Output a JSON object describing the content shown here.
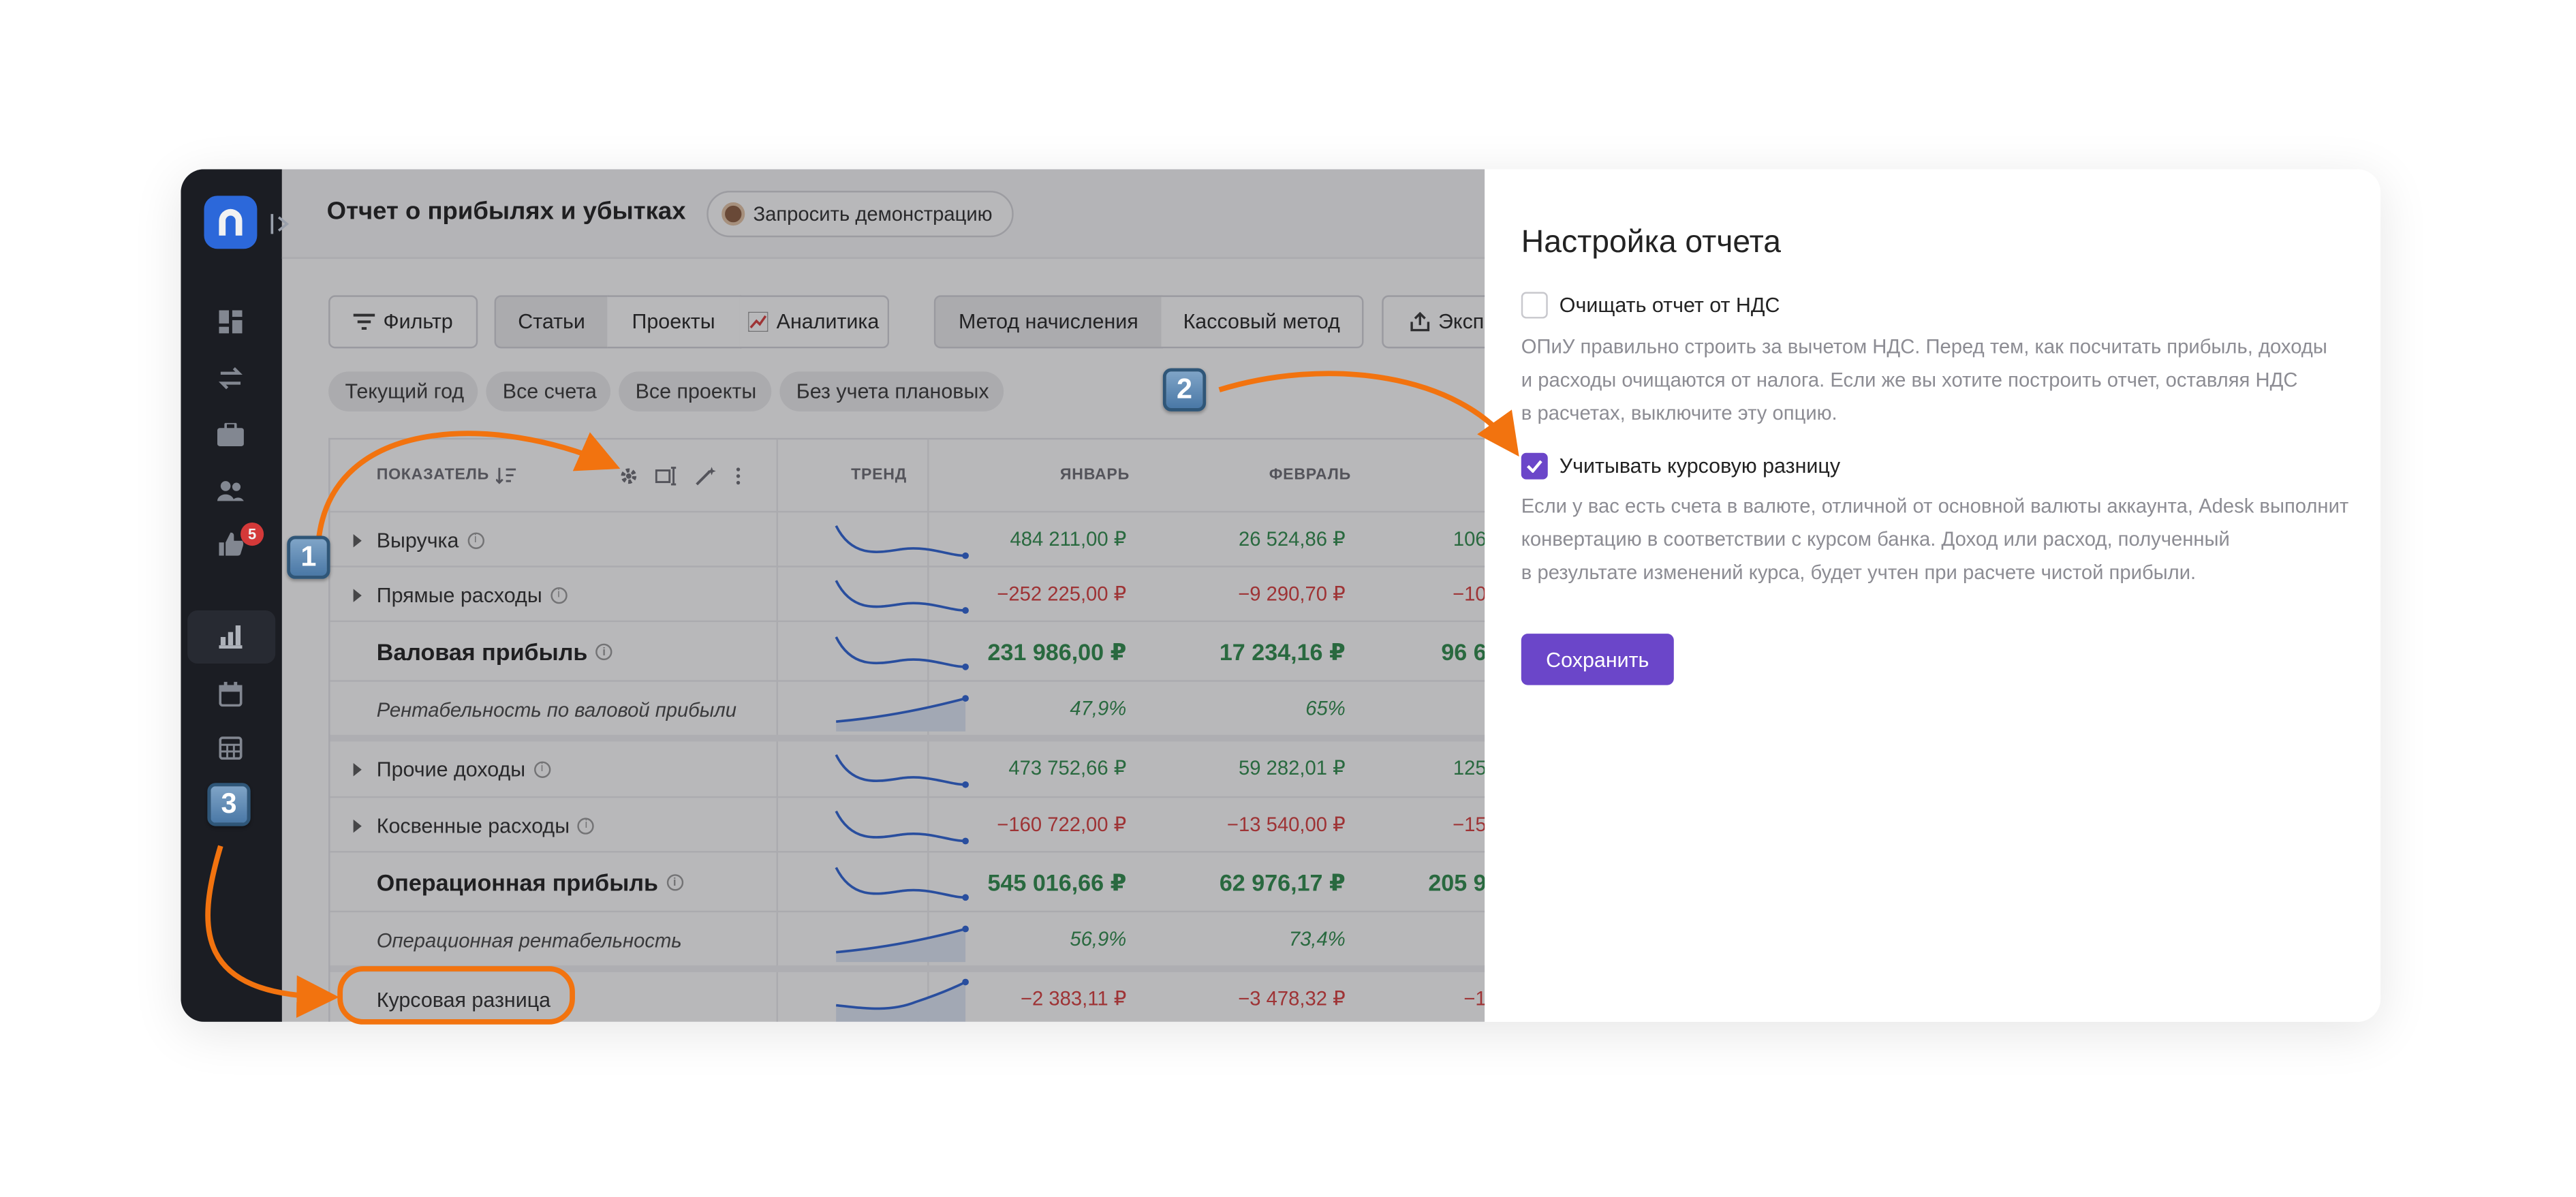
{
  "app": {
    "title": "Отчет о прибылях и убытках",
    "demo_button": "Запросить демонстрацию",
    "sidebar_badge": "5"
  },
  "toolbar": {
    "filter": "Фильтр",
    "tabs": [
      "Статьи",
      "Проекты",
      "Аналитика"
    ],
    "methods": [
      "Метод начисления",
      "Кассовый метод"
    ],
    "export": "Эксп"
  },
  "chips": [
    "Текущий год",
    "Все счета",
    "Все проекты",
    "Без учета плановых"
  ],
  "table": {
    "headers": {
      "indicator": "ПОКАЗАТЕЛЬ",
      "trend": "ТРЕНД",
      "jan": "ЯНВАРЬ",
      "feb": "ФЕВРАЛЬ"
    },
    "rows": [
      {
        "label": "Выручка",
        "jan": "484 211,00 ₽",
        "feb": "26 524,86 ₽",
        "mar": "106"
      },
      {
        "label": "Прямые расходы",
        "jan": "−252 225,00 ₽",
        "feb": "−9 290,70 ₽",
        "mar": "−10"
      },
      {
        "label": "Валовая прибыль",
        "jan": "231 986,00 ₽",
        "feb": "17 234,16 ₽",
        "mar": "96 6"
      },
      {
        "label": "Рентабельность по валовой прибыли",
        "jan": "47,9%",
        "feb": "65%",
        "mar": ""
      },
      {
        "label": "Прочие доходы",
        "jan": "473 752,66 ₽",
        "feb": "59 282,01 ₽",
        "mar": "125"
      },
      {
        "label": "Косвенные расходы",
        "jan": "−160 722,00 ₽",
        "feb": "−13 540,00 ₽",
        "mar": "−15"
      },
      {
        "label": "Операционная прибыль",
        "jan": "545 016,66 ₽",
        "feb": "62 976,17 ₽",
        "mar": "205 9"
      },
      {
        "label": "Операционная рентабельность",
        "jan": "56,9%",
        "feb": "73,4%",
        "mar": ""
      },
      {
        "label": "Курсовая разница",
        "jan": "−2 383,11 ₽",
        "feb": "−3 478,32 ₽",
        "mar": "−1"
      }
    ]
  },
  "panel": {
    "title": "Настройка отчета",
    "vat_label": "Очищать отчет от НДС",
    "vat_hint": [
      "ОПиУ правильно строить за вычетом НДС. Перед тем, как посчитать прибыль, доходы",
      "и расходы очищаются от налога. Если же вы хотите построить отчет, оставляя НДС",
      "в расчетах, выключите эту опцию."
    ],
    "fx_label": "Учитывать курсовую разницу",
    "fx_hint": [
      "Если у вас есть счета в валюте, отличной от основной валюты аккаунта, Adesk выполнит",
      "конвертацию в соответствии с курсом банка. Доход или расход, полученный",
      "в результате изменений курса, будет учтен при расчете чистой прибыли."
    ],
    "save": "Сохранить"
  },
  "annotations": {
    "step1": "1",
    "step2": "2",
    "step3": "3"
  },
  "colors": {
    "accent": "#6b46c9",
    "arrow": "#f2730f",
    "positive": "#2a8a48",
    "negative": "#d83a3a"
  }
}
